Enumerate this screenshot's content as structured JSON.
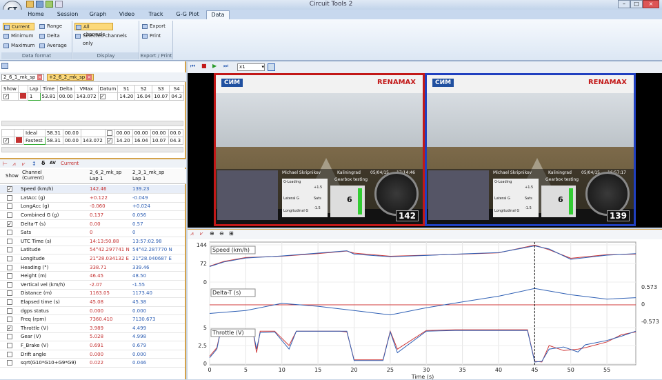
{
  "app": {
    "title": "Circuit Tools 2",
    "logo": "CT"
  },
  "tabs": [
    "Home",
    "Session",
    "Graph",
    "Video",
    "Track",
    "G-G Plot",
    "Data"
  ],
  "ribbon": {
    "data_format": {
      "items": [
        "Current",
        "Minimum",
        "Maximum",
        "Range",
        "Delta",
        "Average"
      ],
      "label": "Data format"
    },
    "display": {
      "items": [
        "All channels",
        "Selected channels only"
      ],
      "label": "Display"
    },
    "export_print": {
      "items": [
        "Export",
        "Print"
      ],
      "label": "Export / Print"
    }
  },
  "laps": {
    "session_tabs": [
      "2_6_1_mk_sp",
      "+2_6_2_mk_sp"
    ],
    "headers": [
      "Show",
      "",
      "Lap",
      "Time",
      "Delta",
      "VMax",
      "Datum",
      "S1",
      "S2",
      "S3",
      "S4"
    ],
    "row1": {
      "lap": "1",
      "time": "53.81",
      "delta": "00.00",
      "vmax": "143.072",
      "s1": "14.20",
      "s2": "16.04",
      "s3": "10.07",
      "s4": "04.3"
    },
    "ideal": {
      "lap": "Ideal",
      "time": "58.31",
      "delta": "00.00",
      "s1": "00.00",
      "s2": "00.00",
      "s3": "00.00",
      "s4": "00.0"
    },
    "fastest": {
      "lap": "Fastest",
      "time": "58.31",
      "delta": "00.00",
      "vmax": "143.072",
      "s1": "14.20",
      "s2": "16.04",
      "s3": "10.07",
      "s4": "04.3"
    }
  },
  "channels": {
    "mode": "Current",
    "headers": {
      "show": "Show",
      "channel": "Channel (Current)",
      "col1": "2_6_2_mk_sp",
      "col1b": "Lap 1",
      "col2": "2_3_1_mk_sp",
      "col2b": "Lap 1"
    },
    "rows": [
      {
        "name": "Speed (km/h)",
        "v1": "142.46",
        "v2": "139.23",
        "checked": true
      },
      {
        "name": "LatAcc (g)",
        "v1": "+0.122",
        "v2": "-0.049",
        "checked": false
      },
      {
        "name": "LongAcc (g)",
        "v1": "-0.060",
        "v2": "+0.024",
        "checked": false
      },
      {
        "name": "Combined G (g)",
        "v1": "0.137",
        "v2": "0.056",
        "checked": false
      },
      {
        "name": "Delta-T (s)",
        "v1": "0.00",
        "v2": "0.57",
        "checked": true
      },
      {
        "name": "Sats",
        "v1": "0",
        "v2": "0",
        "checked": false
      },
      {
        "name": "UTC Time (s)",
        "v1": "14:13:50.88",
        "v2": "13:57:02.98",
        "checked": false
      },
      {
        "name": "Latitude",
        "v1": "54°42.297741 N",
        "v2": "54°42.287770 N",
        "checked": false
      },
      {
        "name": "Longitude",
        "v1": "21°28.034132 E",
        "v2": "21°28.040687 E",
        "checked": false
      },
      {
        "name": "Heading (°)",
        "v1": "338.71",
        "v2": "339.46",
        "checked": false
      },
      {
        "name": "Height (m)",
        "v1": "46.45",
        "v2": "48.50",
        "checked": false
      },
      {
        "name": "Vertical vel (km/h)",
        "v1": "-2.07",
        "v2": "-1.55",
        "checked": false
      },
      {
        "name": "Distance (m)",
        "v1": "1163.05",
        "v2": "1173.40",
        "checked": false
      },
      {
        "name": "Elapsed time (s)",
        "v1": "45.08",
        "v2": "45.38",
        "checked": false
      },
      {
        "name": "dgps status",
        "v1": "0.000",
        "v2": "0.000",
        "checked": false
      },
      {
        "name": "Freq (rpm)",
        "v1": "7360.410",
        "v2": "7130.673",
        "checked": false
      },
      {
        "name": "Throttle (V)",
        "v1": "3.989",
        "v2": "4.499",
        "checked": true
      },
      {
        "name": "Gear (V)",
        "v1": "5.028",
        "v2": "4.998",
        "checked": false
      },
      {
        "name": "F_Brake (V)",
        "v1": "0.691",
        "v2": "0.679",
        "checked": false
      },
      {
        "name": "Drift angle",
        "v1": "0.000",
        "v2": "0.000",
        "checked": false
      },
      {
        "name": "sqrt(G10*G10+G9*G9)",
        "v1": "0.022",
        "v2": "0.046",
        "checked": false
      }
    ]
  },
  "video": {
    "speed_mult": "x1",
    "left": {
      "banner_left": "СИМ",
      "banner_right": "RENAMAX",
      "driver": "Michael Skripnikov",
      "event": "Kaliningrad",
      "event2": "Gearbox testing",
      "date": "05/04/15",
      "time": "17:14:46",
      "gear": "6",
      "speed": "142",
      "labels": [
        "G-Loading",
        "Lateral G",
        "Longitudinal G",
        "Sats",
        "+1.5",
        "-1.5"
      ]
    },
    "right": {
      "banner_left": "СИМ",
      "banner_right": "RENAMAX",
      "driver": "Michael Skripnikov",
      "event": "Kaliningrad",
      "event2": "Gearbox testing",
      "date": "05/04/15",
      "time": "16:57:17",
      "gear": "6",
      "speed": "139",
      "labels": [
        "G-Loading",
        "Lateral G",
        "Longitudinal G",
        "Sats",
        "+1.5",
        "-1.5"
      ]
    }
  },
  "chart_data": {
    "type": "line",
    "xlabel": "Time (s)",
    "xlim": [
      0,
      59
    ],
    "xticks": [
      0,
      5,
      10,
      15,
      20,
      25,
      30,
      35,
      40,
      45,
      50,
      55
    ],
    "cursor_x": 45,
    "colors": {
      "lap_a": "#d03a3a",
      "lap_b": "#2e5fb4"
    },
    "panels": [
      {
        "label": "Speed (km/h)",
        "ylim": [
          0,
          144
        ],
        "yticks": [
          "144",
          "72",
          "0"
        ],
        "series": [
          {
            "x": [
              0,
              2,
              5,
              10,
              15,
              19,
              20,
              25,
              30,
              35,
              40,
              45,
              47,
              50,
              55,
              59
            ],
            "values": [
              62,
              80,
              95,
              100,
              110,
              120,
              112,
              100,
              104,
              108,
              113,
              143,
              125,
              92,
              106,
              108
            ]
          },
          {
            "x": [
              0,
              2,
              5,
              10,
              15,
              19,
              20,
              25,
              30,
              35,
              40,
              45,
              47,
              50,
              55,
              59
            ],
            "values": [
              60,
              78,
              93,
              101,
              112,
              121,
              108,
              98,
              103,
              109,
              114,
              140,
              128,
              88,
              104,
              110
            ]
          }
        ]
      },
      {
        "label": "Delta-T (s)",
        "right_ticks": [
          "0.573",
          "0",
          "-0.573"
        ],
        "series": [
          {
            "x": [
              0,
              59
            ],
            "values": [
              0,
              0
            ]
          },
          {
            "x": [
              0,
              5,
              10,
              15,
              20,
              25,
              30,
              35,
              40,
              45,
              50,
              55,
              59
            ],
            "values": [
              -0.3,
              -0.2,
              0.05,
              -0.05,
              -0.2,
              -0.35,
              -0.1,
              0.1,
              0.3,
              0.57,
              0.35,
              0.2,
              0.25
            ]
          }
        ]
      },
      {
        "label": "Throttle (V)",
        "ylim": [
          0,
          5
        ],
        "yticks": [
          "5",
          "2.5",
          "0"
        ],
        "series": [
          {
            "x": [
              0,
              1,
              1.5,
              3,
              6,
              6.5,
              7,
              9,
              11,
              12,
              18,
              19,
              20,
              24,
              25,
              26,
              30,
              34,
              44,
              45,
              46,
              47,
              49,
              51,
              52,
              55,
              57,
              59
            ],
            "values": [
              1,
              2.2,
              4.5,
              4.5,
              4.5,
              1.5,
              4.5,
              4.5,
              2.5,
              4.5,
              4.5,
              4.4,
              0.5,
              0.5,
              4.5,
              2,
              4.6,
              4.7,
              4.7,
              0.3,
              0.2,
              2.5,
              1.8,
              2,
              2.2,
              3,
              4,
              4.4
            ]
          },
          {
            "x": [
              0,
              1,
              1.5,
              3,
              6,
              6.5,
              7,
              9,
              11,
              12,
              18,
              19,
              20,
              24,
              25,
              26,
              30,
              34,
              44,
              45,
              46,
              47,
              49,
              51,
              52,
              55,
              57,
              59
            ],
            "values": [
              0.8,
              2,
              4.4,
              4.5,
              4.5,
              2,
              4.3,
              4.4,
              2,
              4.5,
              4.5,
              4.5,
              0.4,
              0.4,
              4.4,
              1.5,
              4.5,
              4.6,
              4.6,
              0.2,
              0.3,
              2,
              2.3,
              1.6,
              2.6,
              3.2,
              3.8,
              4.5
            ]
          }
        ]
      }
    ]
  }
}
